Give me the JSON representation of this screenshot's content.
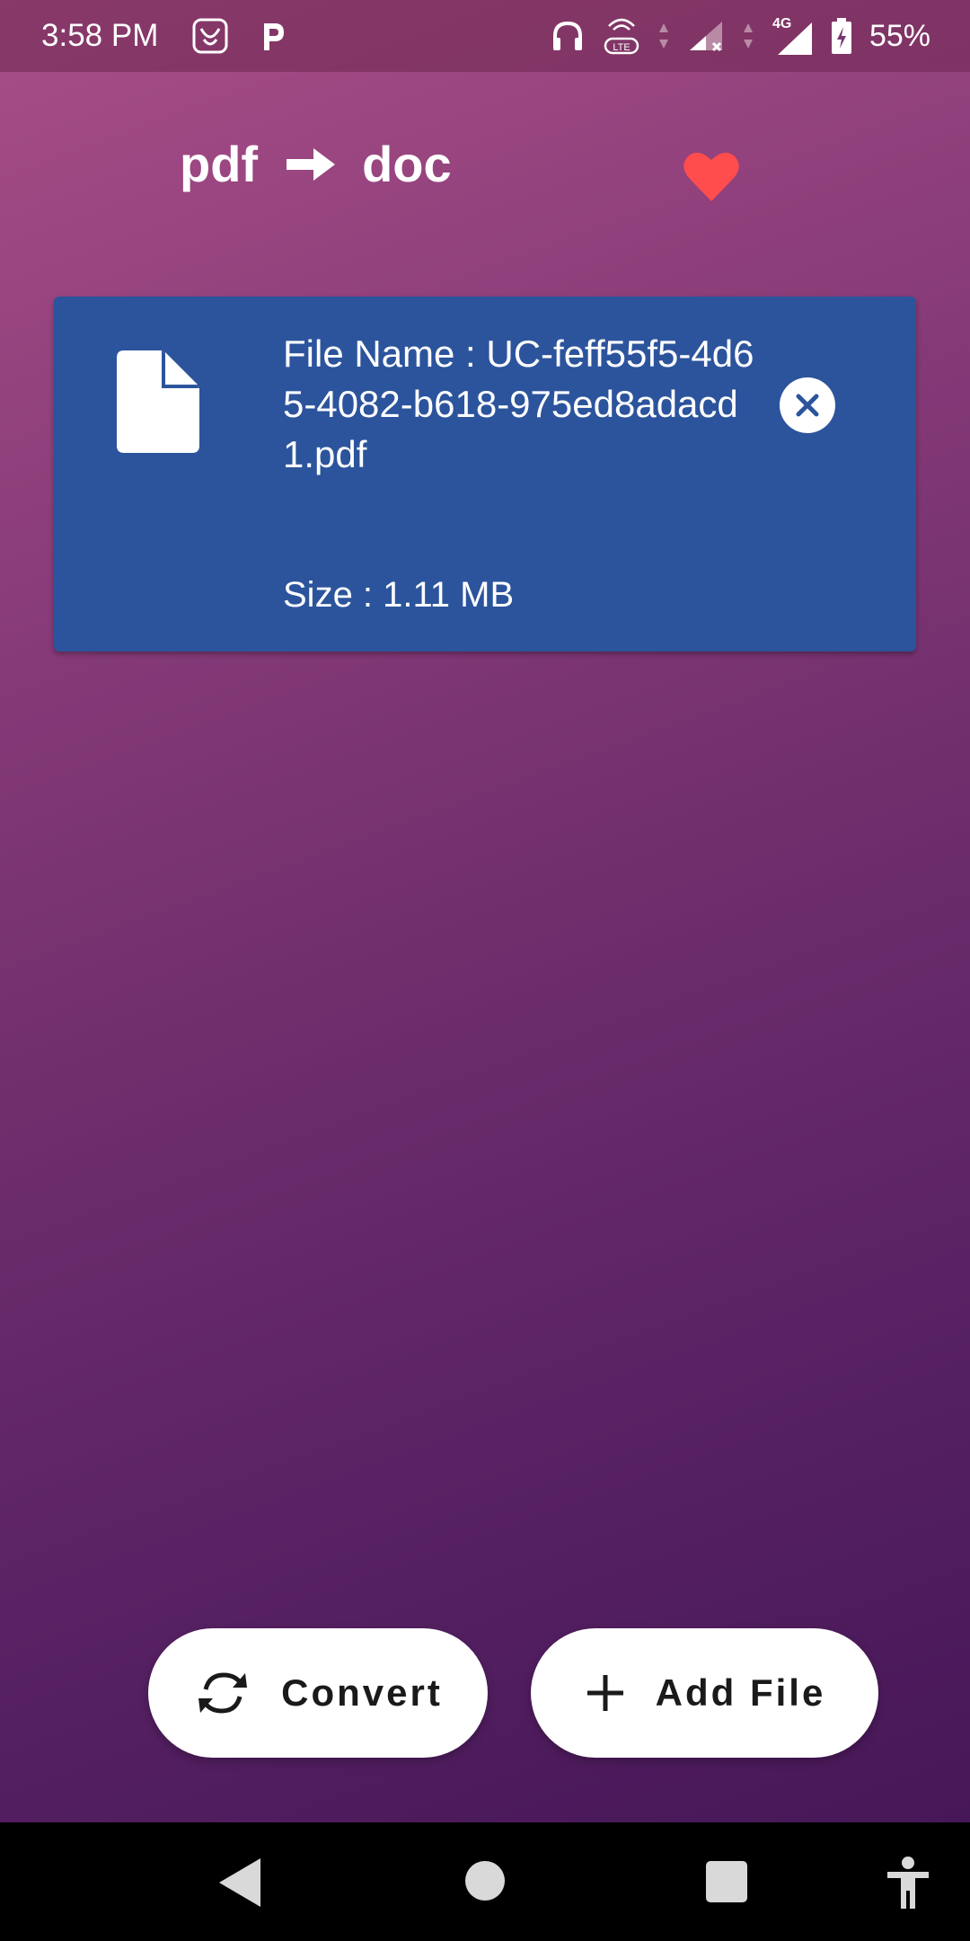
{
  "status_bar": {
    "time": "3:58 PM",
    "battery": "55%",
    "network_label": "4G",
    "volte_label": "LTE",
    "icons": [
      "saavn-icon",
      "paytm-icon",
      "headphones-icon",
      "volte-icon",
      "signal-icon",
      "battery-icon"
    ]
  },
  "header": {
    "from_format": "pdf",
    "to_format": "doc",
    "favorite_color": "#ff4d4d"
  },
  "file_card": {
    "name_label": "File Name : UC-feff55f5-4d65-4082-b618-975ed8adacd1.pdf",
    "size_label": "Size : 1.11 MB",
    "card_color": "#2c549c"
  },
  "actions": {
    "convert_label": "Convert",
    "add_file_label": "Add File"
  },
  "navigation": {
    "items": [
      "back",
      "home",
      "recents",
      "accessibility"
    ]
  }
}
